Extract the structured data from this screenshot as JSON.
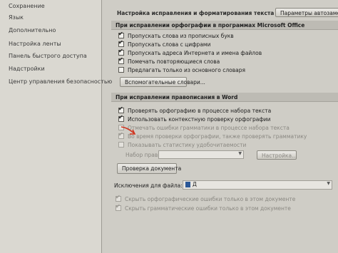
{
  "nav": {
    "items": [
      "Сохранение",
      "Язык",
      "Дополнительно",
      "Настройка ленты",
      "Панель быстрого доступа",
      "Надстройки",
      "Центр управления безопасностью"
    ]
  },
  "autocorrect": {
    "label": "Настройка исправления и форматирования текста при вводе:",
    "button": "Параметры автозамены..."
  },
  "office_section": {
    "title": "При исправлении орфографии в программах Microsoft Office",
    "options": [
      {
        "label": "Пропускать слова из прописных букв",
        "checked": true
      },
      {
        "label": "Пропускать слова с цифрами",
        "checked": true
      },
      {
        "label": "Пропускать адреса Интернета и имена файлов",
        "checked": true
      },
      {
        "label": "Помечать повторяющиеся слова",
        "checked": true
      },
      {
        "label": "Предлагать только из основного словаря",
        "checked": false
      }
    ],
    "dictionaries_button": "Вспомогательные словари..."
  },
  "word_section": {
    "title": "При исправлении правописания в Word",
    "options": [
      {
        "label": "Проверять орфографию в процессе набора текста",
        "checked": true
      },
      {
        "label": "Использовать контекстную проверку орфографии",
        "checked": true
      },
      {
        "label": "Отмечать ошибки грамматики в процессе набора текста",
        "checked": false
      },
      {
        "label": "Во время проверки орфографии, также проверять грамматику",
        "checked": true
      },
      {
        "label": "Показывать статистику удобочитаемости",
        "checked": false
      }
    ],
    "ruleset_label": "Набор правил:",
    "ruleset_value": "",
    "settings_button": "Настройка...",
    "check_document_button": "Проверка документа"
  },
  "exceptions": {
    "label": "Исключения для файла:",
    "file_value": "Д",
    "options": [
      {
        "label": "Скрыть орфографические ошибки только в этом документе",
        "checked": true
      },
      {
        "label": "Скрыть грамматические ошибки только в этом документе",
        "checked": true
      }
    ]
  },
  "colors": {
    "annotation_arrow": "#d0341f"
  }
}
